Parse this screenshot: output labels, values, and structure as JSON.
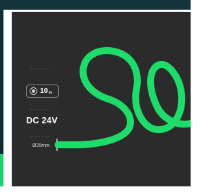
{
  "product": {
    "spec_badge": {
      "icon": "length-icon",
      "value": "10",
      "unit": "m"
    },
    "voltage": "DC 24V",
    "diameter": "Ø25mm"
  },
  "colors": {
    "panel_background": "#2b2b2b",
    "neon_tube": "#1edc6a",
    "top_band": "#13343d",
    "accent_green": "#1ecf6e"
  }
}
